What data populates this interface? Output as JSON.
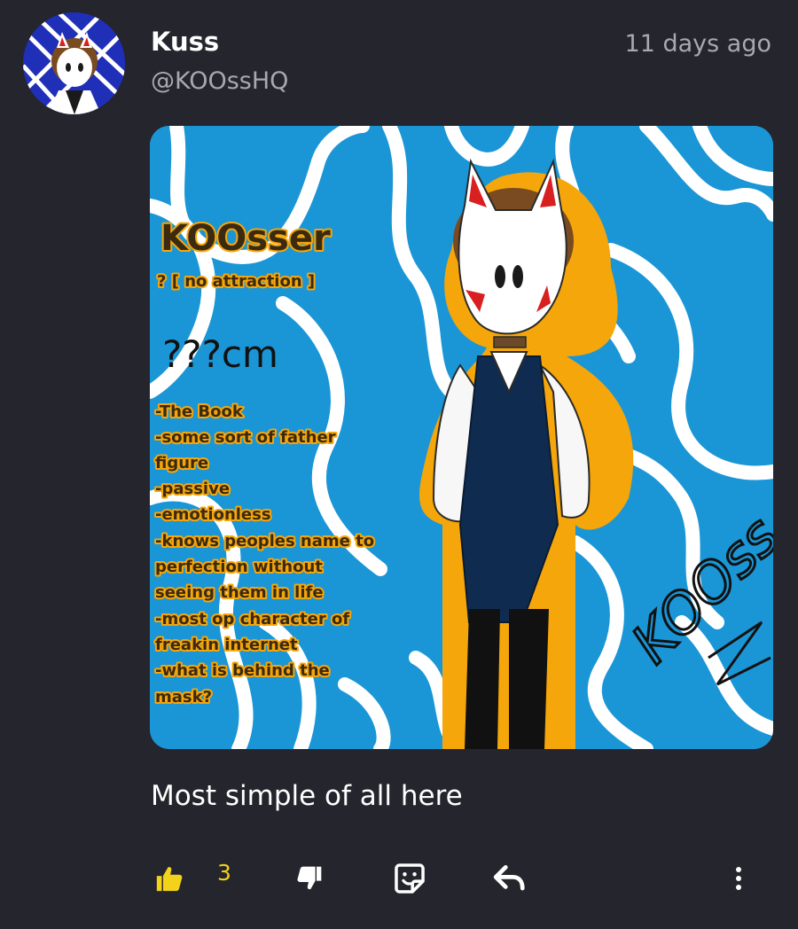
{
  "post": {
    "author_name": "Kuss",
    "author_handle": "@KOOssHQ",
    "timestamp": "11 days ago",
    "caption": "Most simple of all here",
    "image": {
      "title": "KOOsser",
      "subtitle": "? [ no attraction ]",
      "height": "???cm",
      "notes": [
        "-The Book",
        "-some sort of father",
        "figure",
        "-passive",
        "-emotionless",
        "-knows peoples name to",
        "perfection without",
        "seeing them in life",
        "-most op character of",
        "freakin internet",
        "-what is behind the",
        "mask?"
      ],
      "signature": "KOOss"
    }
  },
  "actions": {
    "like_count": "3",
    "like_icon": "thumbs-up-icon",
    "dislike_icon": "thumbs-down-icon",
    "reaction_icon": "sticker-icon",
    "reply_icon": "reply-arrow-icon",
    "more_icon": "more-vertical-icon"
  },
  "colors": {
    "background": "#25252d",
    "accent": "#f2d21b",
    "muted_text": "#a8a8ae",
    "image_blue": "#1a96d6",
    "outline_orange": "#f5a60a"
  }
}
